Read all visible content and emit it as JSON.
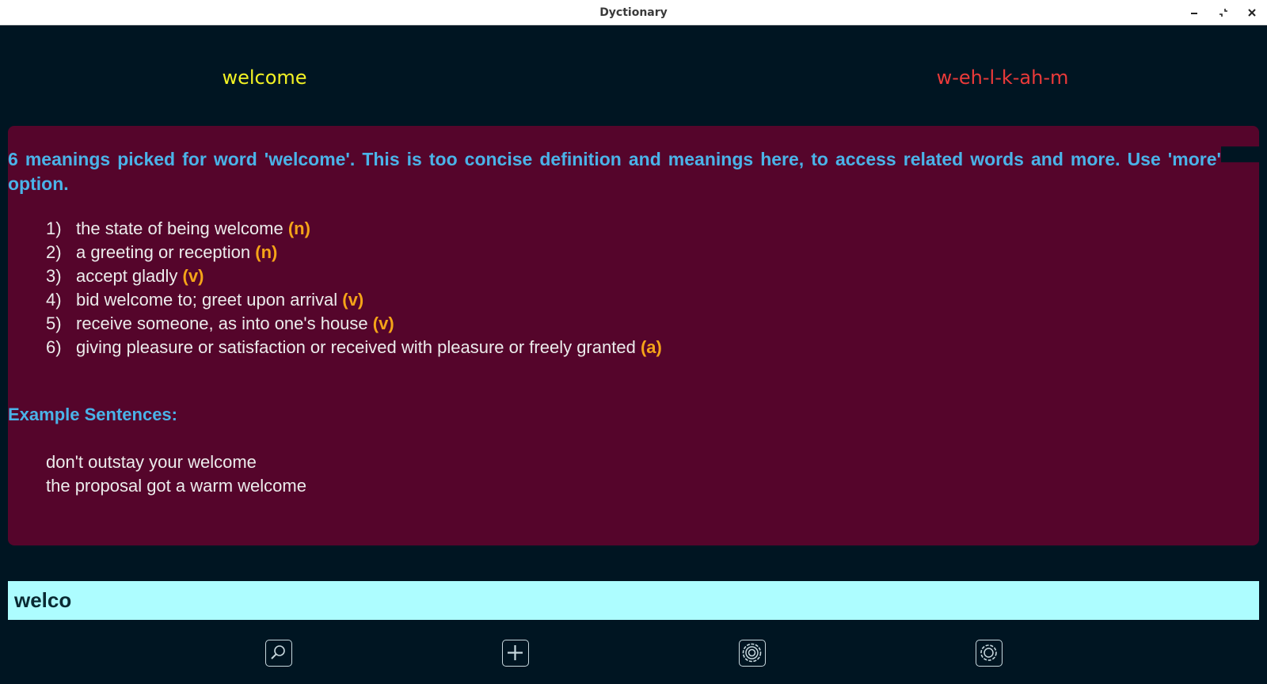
{
  "window": {
    "title": "Dyctionary",
    "controls": [
      "minimize-icon",
      "restore-icon",
      "close-icon"
    ]
  },
  "header": {
    "word": "welcome",
    "phonetic": "w-eh-l-k-ah-m"
  },
  "definition": {
    "intro": "6 meanings picked for word 'welcome'. This is too concise definition and meanings here, to access related words and more. Use 'more' option.",
    "meanings": [
      {
        "num": "1)",
        "text": "the state of being welcome ",
        "pos": "(n)"
      },
      {
        "num": "2)",
        "text": "a greeting or reception ",
        "pos": "(n)"
      },
      {
        "num": "3)",
        "text": "accept gladly ",
        "pos": "(v)"
      },
      {
        "num": "4)",
        "text": "bid welcome to; greet upon arrival ",
        "pos": "(v)"
      },
      {
        "num": "5)",
        "text": "receive someone, as into one's house ",
        "pos": "(v)"
      },
      {
        "num": "6)",
        "text": "giving pleasure or satisfaction or received with pleasure or freely granted ",
        "pos": "(a)"
      }
    ],
    "examples_heading": "Example Sentences:",
    "examples": [
      "don't outstay your welcome",
      "the proposal got a warm welcome"
    ]
  },
  "search": {
    "value": "welco"
  },
  "toolbar": {
    "buttons": [
      "search-icon",
      "add-icon",
      "settings-icon",
      "more-icon"
    ]
  },
  "colors": {
    "background": "#001522",
    "panel": "#55052b",
    "word": "#f2f224",
    "phonetic": "#ea3a3a",
    "heading": "#4ab3e8",
    "part_of_speech": "#f5a418",
    "search_bg": "#adfdff"
  }
}
